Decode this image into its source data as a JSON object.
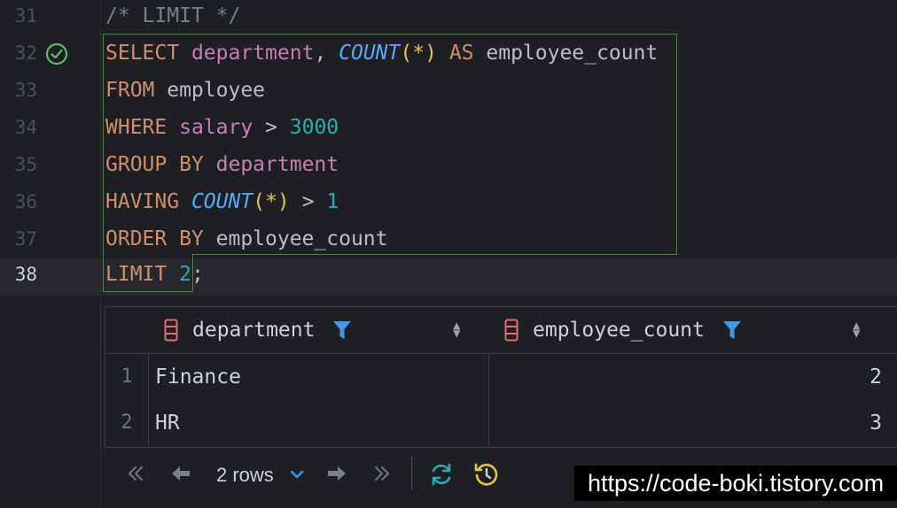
{
  "editor": {
    "lines": [
      {
        "num": "31",
        "parts": [
          {
            "t": "/* LIMIT */",
            "c": "cmt"
          }
        ]
      },
      {
        "num": "32",
        "parts": [
          {
            "t": "SELECT",
            "c": "kw"
          },
          {
            "t": " "
          },
          {
            "t": "department",
            "c": "col"
          },
          {
            "t": ", "
          },
          {
            "t": "COUNT",
            "c": "fn"
          },
          {
            "t": "(",
            "c": "paren"
          },
          {
            "t": "*",
            "c": "paren"
          },
          {
            "t": ")",
            "c": "paren"
          },
          {
            "t": " "
          },
          {
            "t": "AS",
            "c": "kw"
          },
          {
            "t": " employee_count"
          }
        ]
      },
      {
        "num": "33",
        "parts": [
          {
            "t": "FROM",
            "c": "kw"
          },
          {
            "t": " employee"
          }
        ]
      },
      {
        "num": "34",
        "parts": [
          {
            "t": "WHERE",
            "c": "kw"
          },
          {
            "t": " "
          },
          {
            "t": "salary",
            "c": "col"
          },
          {
            "t": " > "
          },
          {
            "t": "3000",
            "c": "num"
          }
        ]
      },
      {
        "num": "35",
        "parts": [
          {
            "t": "GROUP BY",
            "c": "kw"
          },
          {
            "t": " "
          },
          {
            "t": "department",
            "c": "col"
          }
        ]
      },
      {
        "num": "36",
        "parts": [
          {
            "t": "HAVING",
            "c": "kw"
          },
          {
            "t": " "
          },
          {
            "t": "COUNT",
            "c": "fn"
          },
          {
            "t": "(",
            "c": "paren"
          },
          {
            "t": "*",
            "c": "paren"
          },
          {
            "t": ")",
            "c": "paren"
          },
          {
            "t": " > "
          },
          {
            "t": "1",
            "c": "num"
          }
        ]
      },
      {
        "num": "37",
        "parts": [
          {
            "t": "ORDER BY",
            "c": "kw"
          },
          {
            "t": " employee_count"
          }
        ]
      },
      {
        "num": "38",
        "parts": [
          {
            "t": "LIMIT",
            "c": "kw"
          },
          {
            "t": " "
          },
          {
            "t": "2",
            "c": "num"
          },
          {
            "t": ";"
          }
        ]
      }
    ],
    "current_line": "38"
  },
  "results": {
    "columns": [
      {
        "name": "department"
      },
      {
        "name": "employee_count"
      }
    ],
    "rows": [
      {
        "num": "1",
        "department": "Finance",
        "employee_count": "2"
      },
      {
        "num": "2",
        "department": "HR",
        "employee_count": "3"
      }
    ]
  },
  "toolbar": {
    "rows_label": "2 rows",
    "icons": [
      "first-page-icon",
      "prev-page-icon",
      "next-page-icon",
      "last-page-icon",
      "refresh-icon",
      "history-icon"
    ]
  },
  "watermark": "https://code-boki.tistory.com",
  "colors": {
    "keyword": "#cf8e6d",
    "column": "#c77dbb",
    "function": "#56a8f5",
    "number": "#2aacb8",
    "check": "#5fb865",
    "accent": "#3d9be9"
  }
}
